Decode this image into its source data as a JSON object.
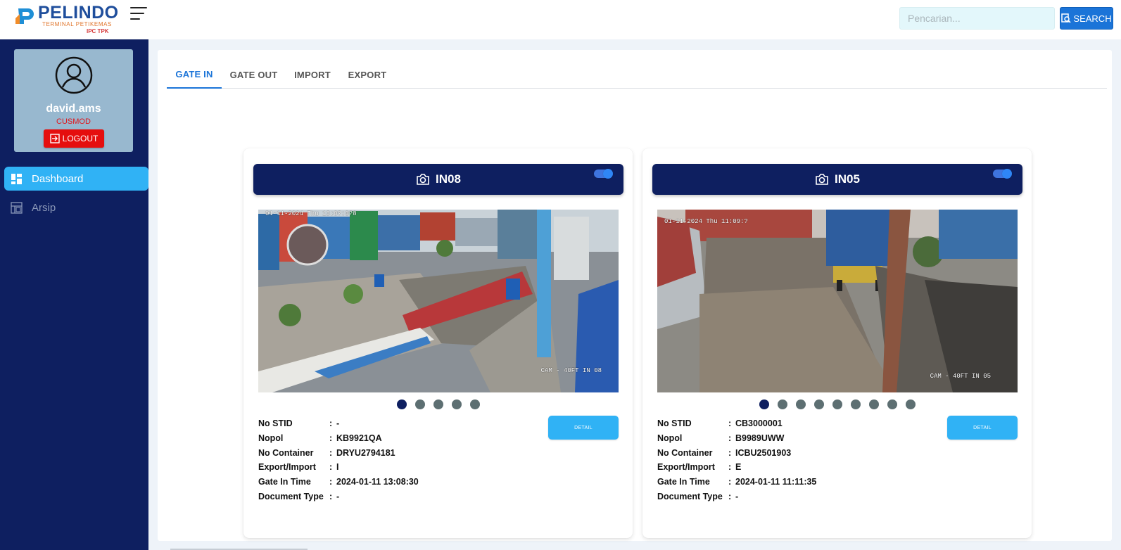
{
  "header": {
    "logo_name": "PELINDO",
    "logo_sub": "TERMINAL PETIKEMAS",
    "logo_sub2": "IPC TPK",
    "search_placeholder": "Pencarian...",
    "search_label": "SEARCH"
  },
  "user": {
    "name": "david.ams",
    "role": "CUSMOD",
    "logout_label": "LOGOUT"
  },
  "sidebar": {
    "items": [
      {
        "label": "Dashboard",
        "icon": "dashboard-icon",
        "active": true
      },
      {
        "label": "Arsip",
        "icon": "archive-icon",
        "active": false
      }
    ]
  },
  "tabs": [
    {
      "label": "GATE IN",
      "active": true
    },
    {
      "label": "GATE OUT",
      "active": false
    },
    {
      "label": "IMPORT",
      "active": false
    },
    {
      "label": "EXPORT",
      "active": false
    }
  ],
  "colors": {
    "navy": "#0e1f60",
    "accent": "#30b2f5",
    "primary": "#1b74d8",
    "danger": "#e50e0e"
  },
  "cards": [
    {
      "camera": "IN08",
      "toggle_on": true,
      "timestamp": "01-11-2024 Thu 13:0?:0?8",
      "cam_label": "CAM - 40FT IN 08",
      "slides": 5,
      "active_slide": 0,
      "detail_label": "DETAIL",
      "labels": [
        "No STID",
        "Nopol",
        "No Container",
        "Export/Import",
        "Gate In Time",
        "Document Type"
      ],
      "values": [
        "-",
        "KB9921QA",
        "DRYU2794181",
        "I",
        "2024-01-11 13:08:30",
        "-"
      ]
    },
    {
      "camera": "IN05",
      "toggle_on": true,
      "timestamp": "01-11-2024 Thu 11:09:?",
      "cam_label": "CAM - 40FT IN 05",
      "slides": 9,
      "active_slide": 0,
      "detail_label": "DETAIL",
      "labels": [
        "No STID",
        "Nopol",
        "No Container",
        "Export/Import",
        "Gate In Time",
        "Document Type"
      ],
      "values": [
        "CB3000001",
        "B9989UWW",
        "ICBU2501903",
        "E",
        "2024-01-11 11:11:35",
        "-"
      ]
    }
  ]
}
